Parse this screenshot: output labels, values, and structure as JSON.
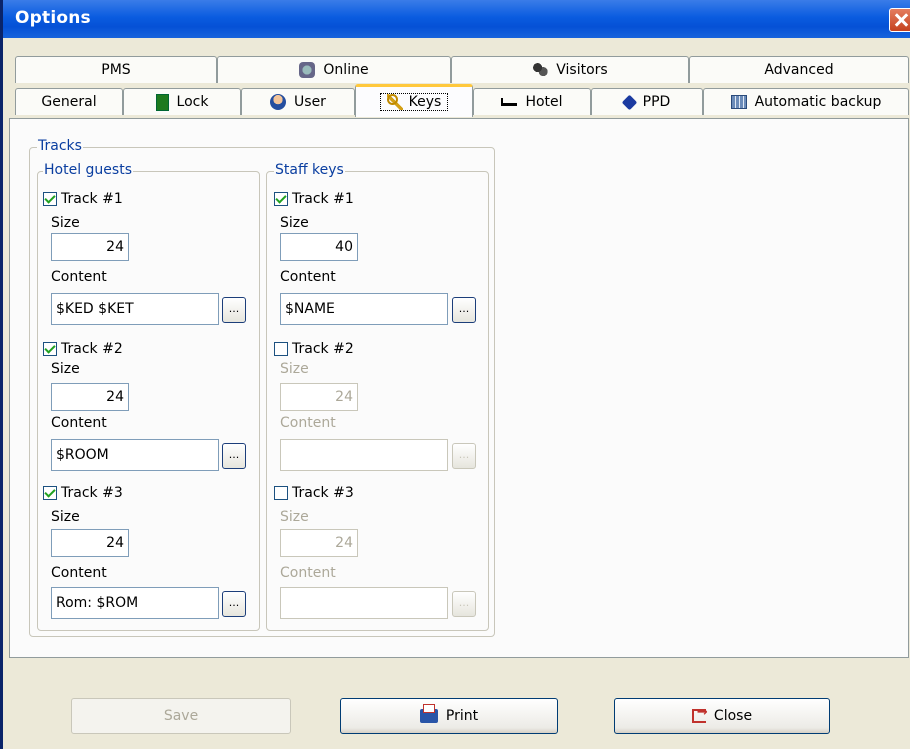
{
  "window": {
    "title": "Options"
  },
  "tabs_row1": [
    {
      "label": "PMS",
      "icon": "none"
    },
    {
      "label": "Online",
      "icon": "online-icon"
    },
    {
      "label": "Visitors",
      "icon": "visitors-icon"
    },
    {
      "label": "Advanced",
      "icon": "none"
    }
  ],
  "tabs_row2": [
    {
      "label": "General",
      "icon": "none"
    },
    {
      "label": "Lock",
      "icon": "lock-icon"
    },
    {
      "label": "User",
      "icon": "user-icon"
    },
    {
      "label": "Keys",
      "icon": "keys-icon",
      "active": true
    },
    {
      "label": "Hotel",
      "icon": "bed-icon"
    },
    {
      "label": "PPD",
      "icon": "ppd-icon"
    },
    {
      "label": "Automatic backup",
      "icon": "calendar-icon"
    }
  ],
  "tracks": {
    "legend": "Tracks",
    "hotel_guests": {
      "legend": "Hotel guests",
      "track1": {
        "label": "Track  #1",
        "checked": true,
        "size_label": "Size",
        "size": "24",
        "content_label": "Content",
        "content": "$KED $KET"
      },
      "track2": {
        "label": "Track  #2",
        "checked": true,
        "size_label": "Size",
        "size": "24",
        "content_label": "Content",
        "content": "$ROOM"
      },
      "track3": {
        "label": "Track  #3",
        "checked": true,
        "size_label": "Size",
        "size": "24",
        "content_label": "Content",
        "content": "Rom: $ROM"
      }
    },
    "staff_keys": {
      "legend": "Staff keys",
      "track1": {
        "label": "Track  #1",
        "checked": true,
        "size_label": "Size",
        "size": "40",
        "content_label": "Content",
        "content": "$NAME"
      },
      "track2": {
        "label": "Track  #2",
        "checked": false,
        "size_label": "Size",
        "size": "24",
        "content_label": "Content",
        "content": ""
      },
      "track3": {
        "label": "Track  #3",
        "checked": false,
        "size_label": "Size",
        "size": "24",
        "content_label": "Content",
        "content": ""
      }
    },
    "browse_label": "..."
  },
  "buttons": {
    "save": "Save",
    "print": "Print",
    "close": "Close"
  },
  "colors": {
    "titlebar": "#0a5ce0",
    "active_tab_accent": "#ffc83c",
    "legend_text": "#0a3ea0"
  }
}
